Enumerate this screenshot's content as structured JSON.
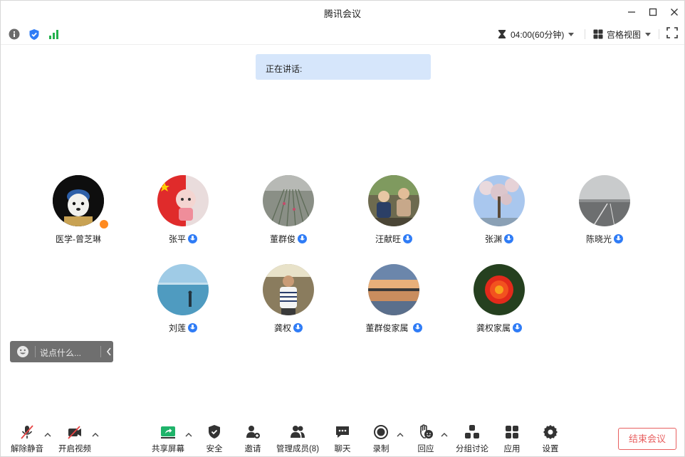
{
  "window": {
    "title": "腾讯会议"
  },
  "infobar": {
    "timer": "04:00(60分钟)",
    "view_mode": "宫格视图"
  },
  "speaker": {
    "label": "正在讲话:"
  },
  "participants": [
    {
      "name": "医学-曾芝琳",
      "avatar": "dog-painting",
      "host": true,
      "mic": false
    },
    {
      "name": "张平",
      "avatar": "red-flag-girl",
      "host": false,
      "mic": true
    },
    {
      "name": "董群俊",
      "avatar": "grass-field",
      "host": false,
      "mic": true
    },
    {
      "name": "汪献旺",
      "avatar": "children",
      "host": false,
      "mic": true
    },
    {
      "name": "张渊",
      "avatar": "blossom-sky",
      "host": false,
      "mic": true
    },
    {
      "name": "陈晓光",
      "avatar": "foggy-road",
      "host": false,
      "mic": true
    },
    {
      "name": "刘莲",
      "avatar": "sea-person",
      "host": false,
      "mic": true
    },
    {
      "name": "龚权",
      "avatar": "man-striped-shirt",
      "host": false,
      "mic": true
    },
    {
      "name": "董群俊家属",
      "avatar": "sunset",
      "host": false,
      "mic": true
    },
    {
      "name": "龚权家属",
      "avatar": "red-rose",
      "host": false,
      "mic": true
    }
  ],
  "chat": {
    "placeholder": "说点什么..."
  },
  "toolbar": {
    "unmute": "解除静音",
    "start_video": "开启视频",
    "share_screen": "共享屏幕",
    "security": "安全",
    "invite": "邀请",
    "manage_members": "管理成员(8)",
    "chat": "聊天",
    "record": "录制",
    "reactions": "回应",
    "breakout": "分组讨论",
    "apps": "应用",
    "settings": "设置",
    "end_meeting": "结束会议"
  },
  "colors": {
    "accent": "#2f7cf6",
    "end": "#e85f5f",
    "speaker_bg": "#d6e6fb",
    "signal": "#22b14c",
    "mute_red": "#e64545",
    "share_green": "#1fb36a"
  }
}
